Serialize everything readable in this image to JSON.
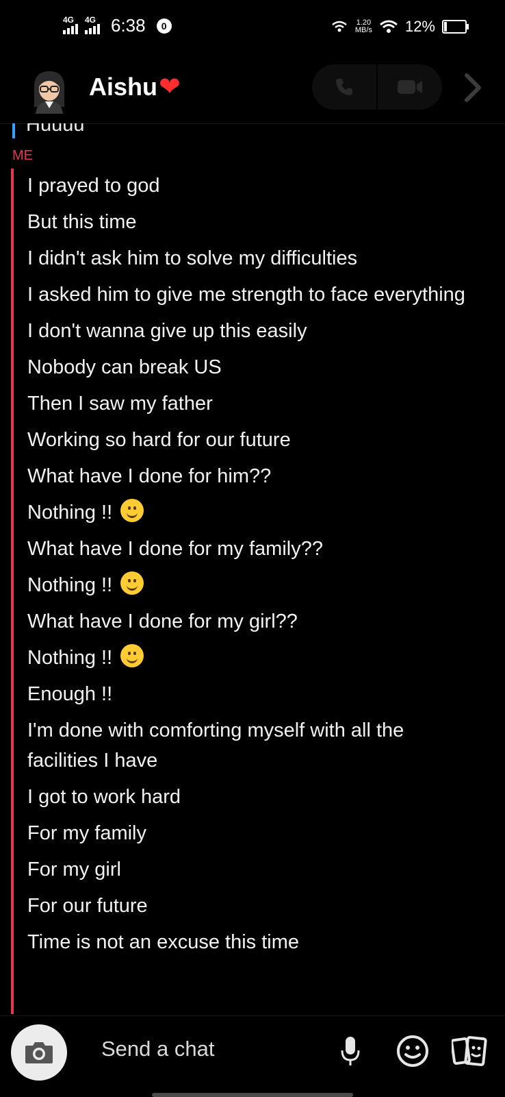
{
  "status_bar": {
    "network1": "4G",
    "network2": "4G",
    "time": "6:38",
    "vpn_badge": "0",
    "speed_value": "1.20",
    "speed_unit": "MB/s",
    "battery": "12%"
  },
  "header": {
    "contact_name": "Aishu",
    "contact_emoji": "❤"
  },
  "chat": {
    "previous_message": "Huuuu",
    "sender_label": "ME",
    "messages": [
      "I prayed to god",
      "But this time",
      "I didn't ask him to solve my difficulties",
      "I asked him to give me strength to face everything",
      "I don't wanna give up this easily",
      "Nobody can break US",
      "Then I saw my father",
      "Working so hard for our future",
      "What have I done for him??",
      "Nothing !!",
      "What have I done for my family??",
      "Nothing !!",
      "What have I done for my girl??",
      "Nothing !!",
      "Enough !!",
      "I'm done with comforting myself with all the facilities I have",
      "I got to work hard",
      "For my family",
      "For my girl",
      "For our future",
      "Time is not an excuse this time"
    ]
  },
  "input": {
    "placeholder": "Send a chat"
  },
  "colors": {
    "me_accent": "#e53750",
    "friend_accent": "#3aa0ff",
    "heart": "#ff2d2d"
  }
}
